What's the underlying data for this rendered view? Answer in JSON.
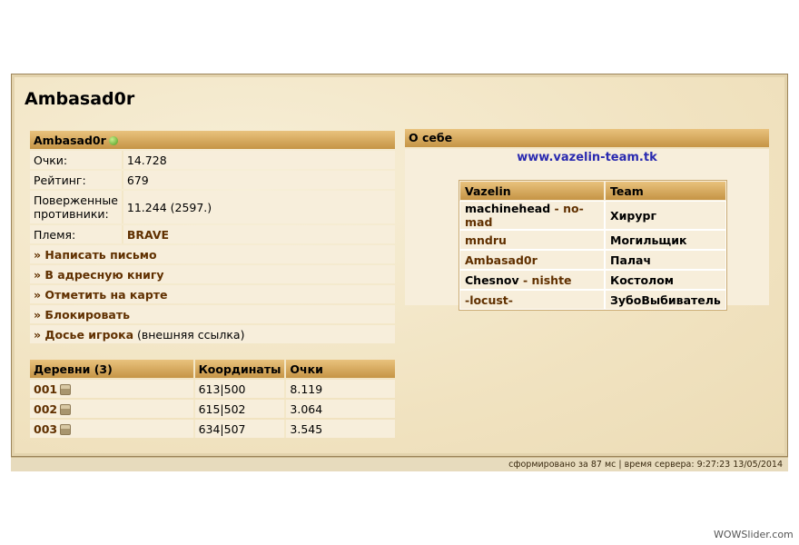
{
  "player": {
    "name": "Ambasad0r",
    "header_name": "Ambasad0r",
    "online_icon": "green-dot-icon"
  },
  "profile": {
    "rows": [
      {
        "label": "Очки:",
        "value": "14.728"
      },
      {
        "label": "Рейтинг:",
        "value": "679"
      },
      {
        "label": "Поверженные противники:",
        "value": "11.244 (2597.)"
      },
      {
        "label": "Племя:",
        "value": "BRAVE"
      }
    ],
    "actions": [
      {
        "label": "» Написать письмо"
      },
      {
        "label": "» В адресную книгу"
      },
      {
        "label": "» Отметить на карте"
      },
      {
        "label": "» Блокировать"
      },
      {
        "label": "» Досье игрока",
        "suffix": " (внешняя ссылка)"
      }
    ]
  },
  "villages": {
    "headers": [
      "Деревни (3)",
      "Координаты",
      "Очки"
    ],
    "rows": [
      {
        "name": "001",
        "coords": "613|500",
        "points": "8.119"
      },
      {
        "name": "002",
        "coords": "615|502",
        "points": "3.064"
      },
      {
        "name": "003",
        "coords": "634|507",
        "points": "3.545"
      }
    ]
  },
  "about": {
    "title": "О себе",
    "link": "www.vazelin-team.tk",
    "team_headers": [
      "Vazelin",
      "Team"
    ],
    "team_rows": [
      {
        "name": "machinehead",
        "sep": " - ",
        "alt": "no-mad",
        "role": "Хирург",
        "style": "black"
      },
      {
        "name": "mndru",
        "sep": "",
        "alt": "",
        "role": "Могильщик",
        "style": "brown"
      },
      {
        "name": "Ambasad0r",
        "sep": "",
        "alt": "",
        "role": "Палач",
        "style": "brown"
      },
      {
        "name": "Chesnov",
        "sep": " - ",
        "alt": "nishte",
        "role": "Костолом",
        "style": "black"
      },
      {
        "name": "-locust-",
        "sep": "",
        "alt": "",
        "role": "ЗубоВыбиватель",
        "style": "brown"
      }
    ]
  },
  "footer": {
    "text": "сформировано за 87 мс | время сервера: 9:27:23 13/05/2014"
  },
  "watermark": "WOWSlider.com",
  "colors": {
    "header_gradient_top": "#e9c27d",
    "header_gradient_bottom": "#c59445",
    "link_brown": "#603000",
    "site_link_blue": "#2a2ab0",
    "online_green": "#4a9a1c"
  }
}
